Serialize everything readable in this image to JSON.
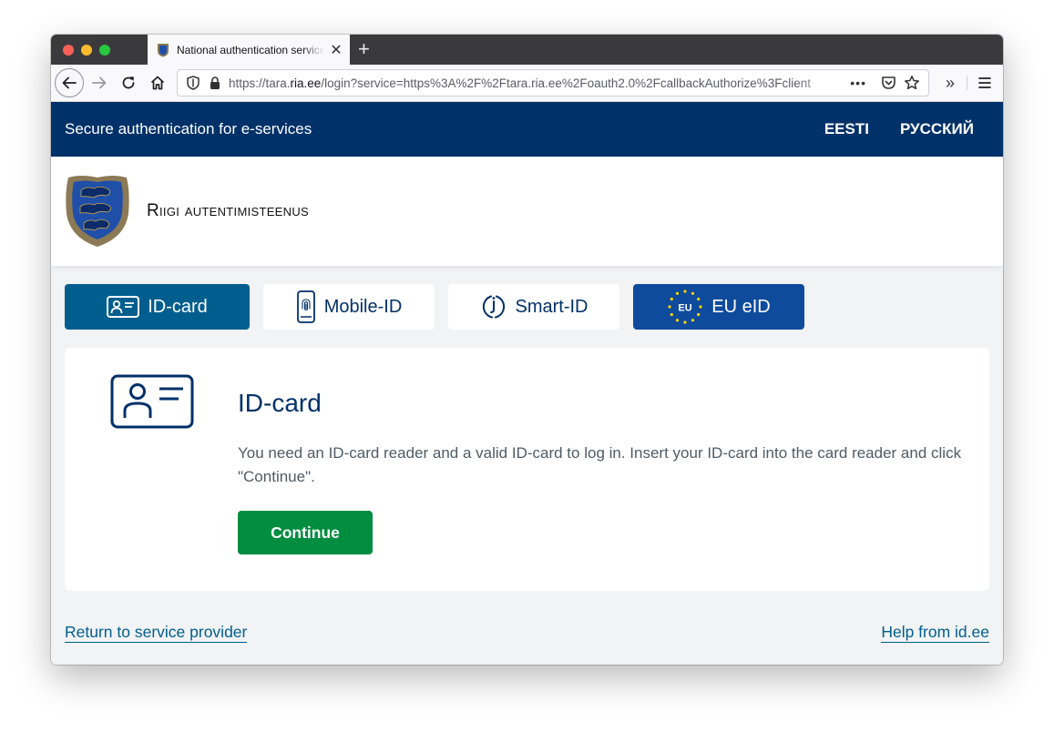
{
  "browser": {
    "tab_title": "National authentication service",
    "url_prefix": "https://tara.",
    "url_domain": "ria.ee",
    "url_rest": "/login?service=https%3A%2F%2Ftara.ria.ee%2Foauth2.0%2FcallbackAuthorize%3Fclient",
    "url_more": "•••",
    "new_tab": "+",
    "tab_close": "✕",
    "overflow": "»"
  },
  "header": {
    "title": "Secure authentication for e-services",
    "languages": [
      "EESTI",
      "РУССКИЙ"
    ]
  },
  "brand": {
    "name": "Riigi autentimisteenus"
  },
  "methods": [
    {
      "label": "ID-card",
      "icon": "id-card-icon",
      "active": true
    },
    {
      "label": "Mobile-ID",
      "icon": "mobile-id-icon",
      "active": false
    },
    {
      "label": "Smart-ID",
      "icon": "smart-id-icon",
      "active": false
    },
    {
      "label": "EU eID",
      "icon": "eu-flag-icon",
      "active": false,
      "badge": "EU"
    }
  ],
  "card": {
    "title": "ID-card",
    "text": "You need an ID-card reader and a valid ID-card to log in. Insert your ID-card into the card reader and click \"Continue\".",
    "button": "Continue"
  },
  "footer": {
    "return_link": "Return to service provider",
    "help_link": "Help from id.ee"
  },
  "colors": {
    "header_bg": "#003168",
    "active_tab": "#005e8e",
    "eu_tab": "#0e4b9d",
    "continue_button": "#008d3f",
    "link": "#005e8e"
  }
}
